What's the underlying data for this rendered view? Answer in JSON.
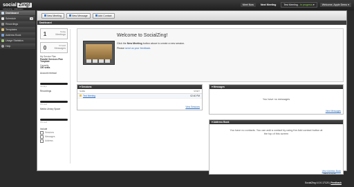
{
  "brand": {
    "name_left": "social",
    "name_right": "Zing!",
    "tagline": "conferencing · collaboration"
  },
  "topbar": {
    "meet_now": "Meet Now",
    "next_meeting": "Next Meeting",
    "meeting_select": "Test Meeting",
    "meeting_status": "- In progress",
    "welcome": "Welcome, Apple Demo"
  },
  "sidebar": {
    "items": [
      {
        "label": "Dashboard",
        "icon": "dashboard-icon"
      },
      {
        "label": "Schedule",
        "icon": "calendar-icon",
        "badge": "0"
      },
      {
        "label": "Recordings",
        "icon": "film-icon"
      },
      {
        "label": "Templates",
        "icon": "template-icon"
      },
      {
        "label": "Address Book",
        "icon": "address-book-icon"
      },
      {
        "label": "Usage Statistics",
        "icon": "chart-icon"
      },
      {
        "label": "Help",
        "icon": "help-icon"
      }
    ]
  },
  "toolbar": {
    "new_meeting": "New Meeting",
    "new_message": "New Message",
    "add_contact": "Add Contact"
  },
  "breadcrumb": "Dashboard",
  "stats": [
    {
      "value": "1",
      "label_top": "Today",
      "label_bottom": "Meetings"
    },
    {
      "value": "0",
      "label_top": "Unread",
      "label_bottom": "Messages"
    }
  ],
  "plan": {
    "title_key": "My Service Plan",
    "title_value": "Parallel Services Plan Template",
    "capacity_key": "Capacity",
    "capacity_value": "100 seats",
    "account_renewal": "Account renewal",
    "account_sub": "n/a days",
    "recordings": "Recordings",
    "recordings_sub": "0% used",
    "media_space": "Media Library Space",
    "media_sub": "0% used"
  },
  "include": {
    "title": "Include",
    "options": [
      "Sessions",
      "Messages",
      "Address"
    ]
  },
  "welcome": {
    "title": "Welcome to SocialZing!",
    "line1_pre": "Click the ",
    "line1_bold": "New Meeting",
    "line1_post": " button above to create a new session.",
    "line2_pre": "Please ",
    "line2_link": "send us your feedback",
    "line2_post": "."
  },
  "sessions": {
    "title": "Sessions",
    "col_name": "NAME",
    "col_start": "START",
    "rows": [
      {
        "name": "Test Meeting",
        "start": "02:40 PM"
      }
    ],
    "view_link": "View Sessions"
  },
  "messages": {
    "title": "Messages",
    "empty": "You have no messages",
    "view_link": "View Messages"
  },
  "address_book": {
    "title": "Address Book",
    "empty": "You have no contacts. You can add a contact by using the Add contact button at the top of this screen",
    "view_link": "View Address Book"
  },
  "back_to_top": "Back to top",
  "footer": {
    "version": "SocialZing 4.0.0.17120",
    "separator": "|",
    "feedback": "Feedback"
  },
  "colors": {
    "accent": "#2a6bbd",
    "dark": "#2b2b2b",
    "status_green": "#8fd14f"
  }
}
